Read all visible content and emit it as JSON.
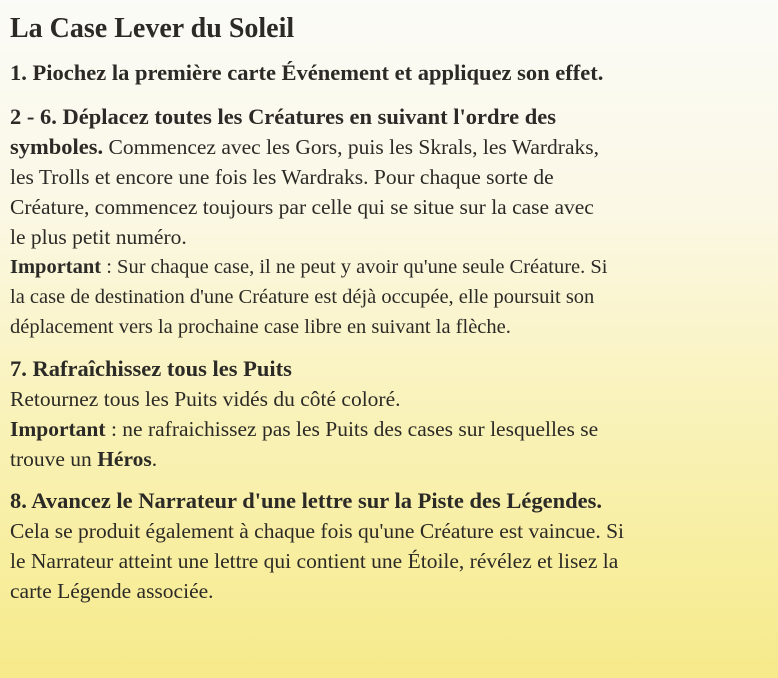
{
  "title": "La Case Lever du Soleil",
  "step1": {
    "heading": "1. Piochez la première carte Événement et appliquez son effet."
  },
  "step2": {
    "heading_part1": "2 - 6. Déplacez toutes les Créatures en suivant l'ordre des",
    "heading_part2": "symboles.",
    "body_line1_tail": " Commencez avec les Gors, puis les Skrals, les Wardraks,",
    "body_line2": "les Trolls et encore une fois les Wardraks. Pour chaque sorte de",
    "body_line3": "Créature, commencez toujours par celle qui se situe sur la case avec",
    "body_line4": "le plus petit numéro.",
    "important_label": "Important",
    "important_line1": " : Sur chaque case, il ne peut y avoir qu'une seule Créature. Si",
    "important_line2": "la case de destination d'une Créature est déjà occupée, elle poursuit son",
    "important_line3": "déplacement vers la prochaine case libre en suivant la flèche."
  },
  "step7": {
    "heading": "7. Rafraîchissez tous les Puits",
    "body": "Retournez tous les Puits vidés du côté coloré.",
    "important_label": "Important",
    "important_line1": " : ne rafraichissez pas les Puits des cases sur lesquelles se",
    "important_line2_pre": "trouve un ",
    "important_line2_bold": "Héros",
    "important_line2_post": "."
  },
  "step8": {
    "heading": "8. Avancez le Narrateur d'une lettre sur la Piste des Légendes.",
    "body_line1": "Cela se produit également à chaque fois qu'une Créature est vaincue. Si",
    "body_line2": "le Narrateur atteint une lettre qui contient une Étoile, révélez et lisez la",
    "body_line3": "carte Légende associée."
  }
}
